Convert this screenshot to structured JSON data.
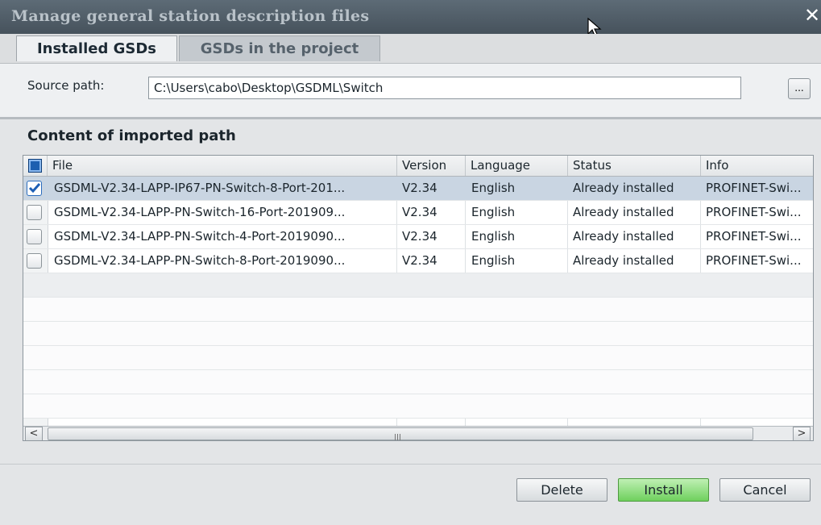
{
  "window": {
    "title": "Manage general station description files",
    "close_glyph": "✕"
  },
  "tabs": [
    {
      "label": "Installed GSDs",
      "active": true
    },
    {
      "label": "GSDs in the project",
      "active": false
    }
  ],
  "source": {
    "label": "Source path:",
    "value": "C:\\Users\\cabo\\Desktop\\GSDML\\Switch",
    "browse_label": "..."
  },
  "content": {
    "title": "Content of imported path",
    "columns": [
      "File",
      "Version",
      "Language",
      "Status",
      "Info"
    ],
    "rows": [
      {
        "checked": true,
        "file": "GSDML-V2.34-LAPP-IP67-PN-Switch-8-Port-201...",
        "version": "V2.34",
        "language": "English",
        "status": "Already installed",
        "info": "PROFINET-Swi..."
      },
      {
        "checked": false,
        "file": "GSDML-V2.34-LAPP-PN-Switch-16-Port-201909...",
        "version": "V2.34",
        "language": "English",
        "status": "Already installed",
        "info": "PROFINET-Swi..."
      },
      {
        "checked": false,
        "file": "GSDML-V2.34-LAPP-PN-Switch-4-Port-2019090...",
        "version": "V2.34",
        "language": "English",
        "status": "Already installed",
        "info": "PROFINET-Swi..."
      },
      {
        "checked": false,
        "file": "GSDML-V2.34-LAPP-PN-Switch-8-Port-2019090...",
        "version": "V2.34",
        "language": "English",
        "status": "Already installed",
        "info": "PROFINET-Swi..."
      }
    ]
  },
  "scrollbar": {
    "left": "<",
    "right": ">"
  },
  "buttons": {
    "delete": "Delete",
    "install": "Install",
    "cancel": "Cancel"
  },
  "colors": {
    "titlebar": "#4f5b65",
    "selected_row": "#c9d5e2",
    "install_button": "#7fd86b"
  },
  "icons": {
    "cursor": "mouse-pointer-icon",
    "checkbox": "checkmark-icon"
  }
}
